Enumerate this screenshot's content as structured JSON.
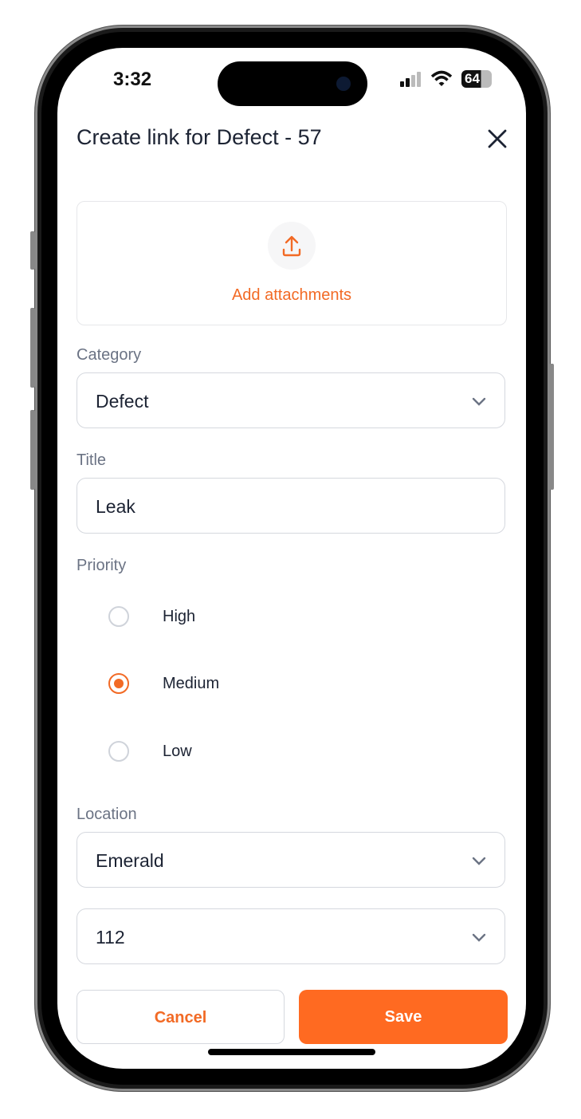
{
  "status_bar": {
    "time": "3:32",
    "battery": "64",
    "icons": [
      "signal-icon",
      "wifi-icon",
      "battery-icon"
    ]
  },
  "header": {
    "title": "Create link for Defect - 57",
    "close_icon": "close-icon"
  },
  "attachments": {
    "label": "Add attachments",
    "icon": "upload-icon"
  },
  "form": {
    "category": {
      "label": "Category",
      "value": "Defect"
    },
    "title": {
      "label": "Title",
      "value": "Leak"
    },
    "priority": {
      "label": "Priority",
      "options": [
        {
          "label": "High",
          "selected": false
        },
        {
          "label": "Medium",
          "selected": true
        },
        {
          "label": "Low",
          "selected": false
        }
      ]
    },
    "location": {
      "label": "Location",
      "value": "Emerald",
      "sub_value": "112"
    }
  },
  "actions": {
    "cancel": "Cancel",
    "save": "Save"
  },
  "colors": {
    "accent": "#ff6a21",
    "text": "#1c2333",
    "label": "#6b7384",
    "border": "#d5d8de"
  }
}
